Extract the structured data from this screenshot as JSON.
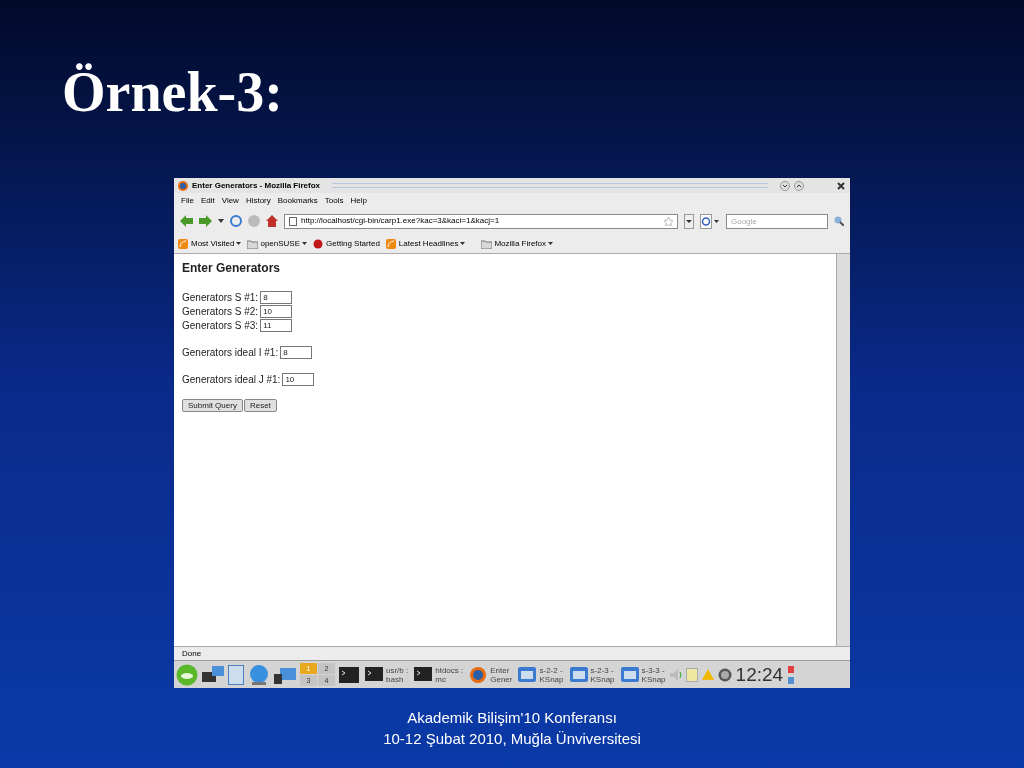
{
  "slide": {
    "title": "Örnek-3:",
    "footer": [
      "Akademik Bilişim'10 Konferansı",
      "10-12 Şubat 2010, Muğla Ünviversitesi"
    ]
  },
  "browser": {
    "window_title": "Enter Generators - Mozilla Firefox",
    "menu": [
      "File",
      "Edit",
      "View",
      "History",
      "Bookmarks",
      "Tools",
      "Help"
    ],
    "url": "http://localhost/cgi-bin/carp1.exe?kac=3&kaci=1&kacj=1",
    "search": {
      "placeholder": "Google"
    },
    "bookmarks": [
      {
        "label": "Most Visited",
        "kind": "feed",
        "dropdown": true
      },
      {
        "label": "openSUSE",
        "kind": "folder",
        "dropdown": true
      },
      {
        "label": "Getting Started",
        "kind": "page",
        "dropdown": false
      },
      {
        "label": "Latest Headlines",
        "kind": "feed",
        "dropdown": true
      },
      {
        "label": "Mozilla Firefox",
        "kind": "folder",
        "dropdown": true
      }
    ],
    "page": {
      "heading": "Enter Generators",
      "field_groups": [
        [
          {
            "label": "Generators S #1:",
            "value": "8"
          },
          {
            "label": "Generators S #2:",
            "value": "10"
          },
          {
            "label": "Generators S #3:",
            "value": "11"
          }
        ],
        [
          {
            "label": "Generators ideal I #1:",
            "value": "8"
          }
        ],
        [
          {
            "label": "Generators ideal J #1:",
            "value": "10"
          }
        ]
      ],
      "buttons": [
        "Submit Query",
        "Reset"
      ]
    },
    "status_bar": "Done"
  },
  "taskbar": {
    "pager": [
      {
        "label": "1",
        "selected": true
      },
      {
        "label": "2",
        "selected": false
      },
      {
        "label": "3",
        "selected": false
      },
      {
        "label": "4",
        "selected": false
      }
    ],
    "tasks": [
      {
        "kind": "terminal",
        "lines": [
          "usr/b :",
          "bash"
        ]
      },
      {
        "kind": "terminal",
        "lines": [
          "htdocs :",
          "mc"
        ]
      },
      {
        "kind": "firefox",
        "lines": [
          "Enter",
          "Gener"
        ]
      },
      {
        "kind": "ksnap",
        "lines": [
          "s-2-2 -",
          "KSnap"
        ]
      },
      {
        "kind": "ksnap",
        "lines": [
          "s-2-3 -",
          "KSnap"
        ]
      },
      {
        "kind": "ksnap",
        "lines": [
          "s-3-3 -",
          "KSnap"
        ]
      }
    ],
    "clock": "12:24"
  }
}
